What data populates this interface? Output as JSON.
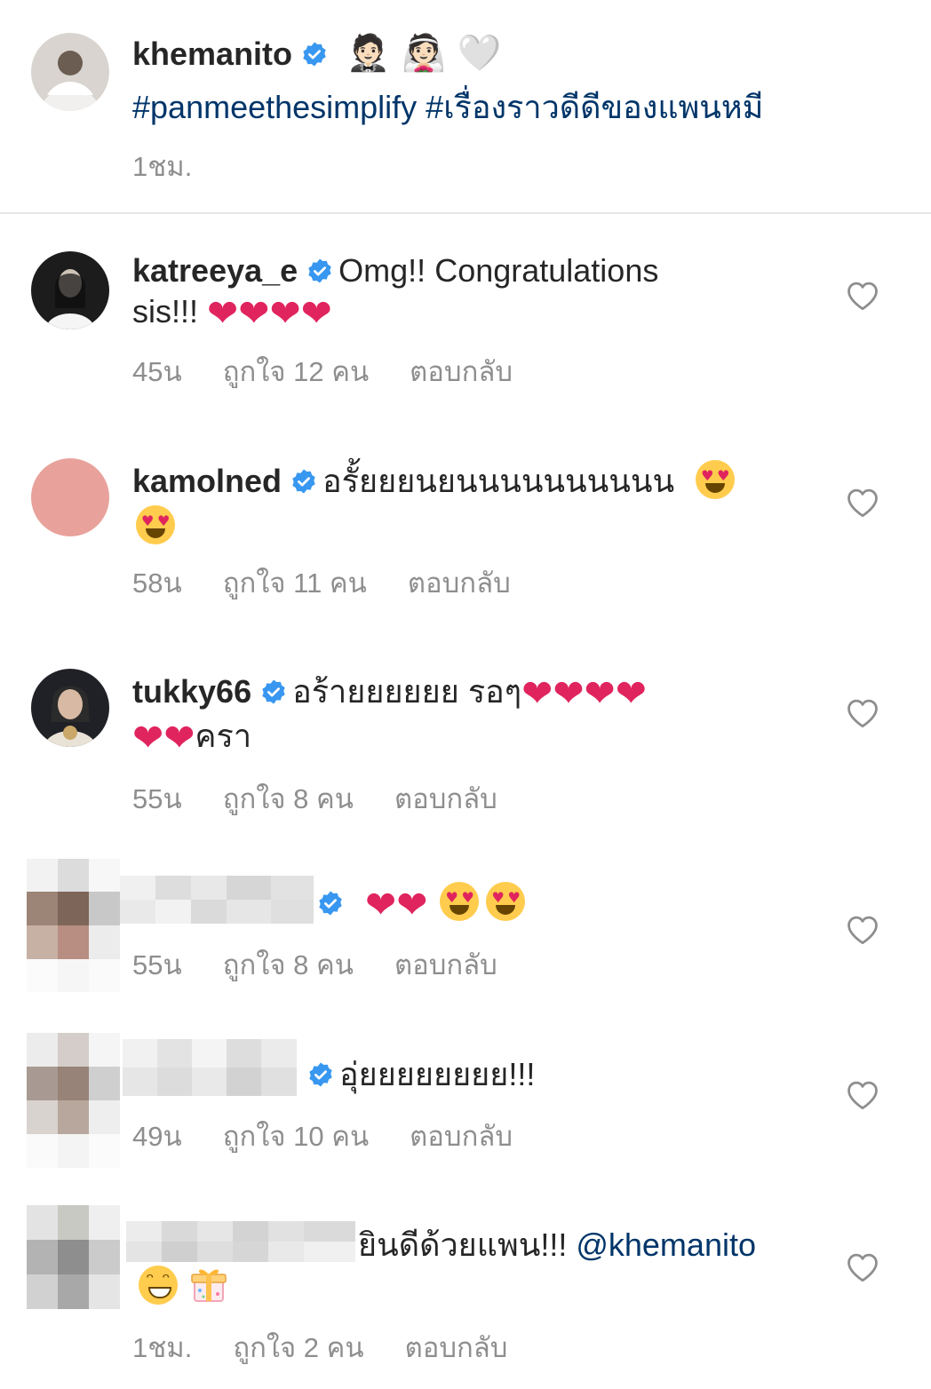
{
  "post": {
    "username": "khemanito",
    "title_emojis": "🤵🏻 👰🏻 🤍",
    "hashtags": "#panmeethesimplify #เรื่องราวดีดีของแพนหมี",
    "time": "1ชม."
  },
  "comments": [
    {
      "username": "katreeya_e",
      "text_line1": "Omg!! Congratulations",
      "text_line2": "sis!!!",
      "time": "45น",
      "likes": "ถูกใจ 12 คน",
      "reply": "ตอบกลับ"
    },
    {
      "username": "kamolned",
      "text_line1": "อรั้ยยยนยนนนนนนนนนน",
      "time": "58น",
      "likes": "ถูกใจ 11 คน",
      "reply": "ตอบกลับ"
    },
    {
      "username": "tukky66",
      "text_line1": "อร้ายยยยยย รอๆ",
      "text_line2": "ครา",
      "time": "55น",
      "likes": "ถูกใจ 8 คน",
      "reply": "ตอบกลับ"
    },
    {
      "username": "",
      "time": "55น",
      "likes": "ถูกใจ 8 คน",
      "reply": "ตอบกลับ"
    },
    {
      "username": "",
      "text_line1": "อุ่ยยยยยยยย!!!",
      "time": "49น",
      "likes": "ถูกใจ 10 คน",
      "reply": "ตอบกลับ"
    },
    {
      "username": "",
      "text_line1": "ยินดีด้วยแพน!!!",
      "mention": "@khemanito",
      "time": "1ชม.",
      "likes": "ถูกใจ 2 คน",
      "reply": "ตอบกลับ"
    }
  ],
  "icons": {
    "verified": "verified-badge-icon",
    "like": "heart-outline-icon",
    "heart": "red-heart-emoji",
    "heart_eyes": "heart-eyes-emoji",
    "grin": "grinning-emoji",
    "gift": "gift-emoji"
  },
  "colors": {
    "verified_blue": "#3897f0",
    "hashtag": "#003569",
    "meta_gray": "#8e8e8e",
    "heart_red": "#e0245e"
  }
}
